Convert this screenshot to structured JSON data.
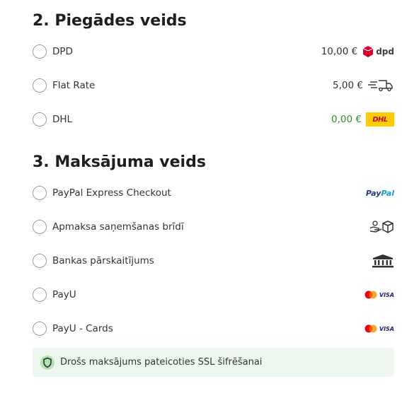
{
  "shipping": {
    "title": "2. Piegādes veids",
    "options": [
      {
        "label": "DPD",
        "price": "10,00 €",
        "logo": "dpd-logo",
        "logo_text": "dpd"
      },
      {
        "label": "Flat Rate",
        "price": "5,00 €",
        "logo": "delivery-truck-icon"
      },
      {
        "label": "DHL",
        "price": "0,00 €",
        "logo": "dhl-logo",
        "logo_text": "DHL",
        "price_color": "#2e8b2e"
      }
    ]
  },
  "payment": {
    "title": "3. Maksājuma veids",
    "options": [
      {
        "label": "PayPal Express Checkout",
        "logo": "paypal-logo",
        "logo_text": "PayPal"
      },
      {
        "label": "Apmaksa saņemšanas brīdī",
        "logo": "cash-on-delivery-icon"
      },
      {
        "label": "Bankas pārskaitījums",
        "logo": "bank-icon"
      },
      {
        "label": "PayU",
        "logo": "mastercard-visa-logo",
        "logo_text": "VISA"
      },
      {
        "label": "PayU - Cards",
        "logo": "mastercard-visa-logo",
        "logo_text": "VISA"
      }
    ]
  },
  "ssl_notice": {
    "text": "Drošs maksājums pateicoties SSL šifrēšanai",
    "icon": "shield-icon"
  },
  "colors": {
    "dpd_red": "#dc0032",
    "dhl_yellow": "#ffcc00",
    "dhl_red": "#d40511",
    "paypal_dark": "#253b80",
    "paypal_light": "#179bd7",
    "free_price": "#2e8b2e",
    "ssl_bg": "#eef7ee",
    "shield_green": "#2e6b2e"
  }
}
